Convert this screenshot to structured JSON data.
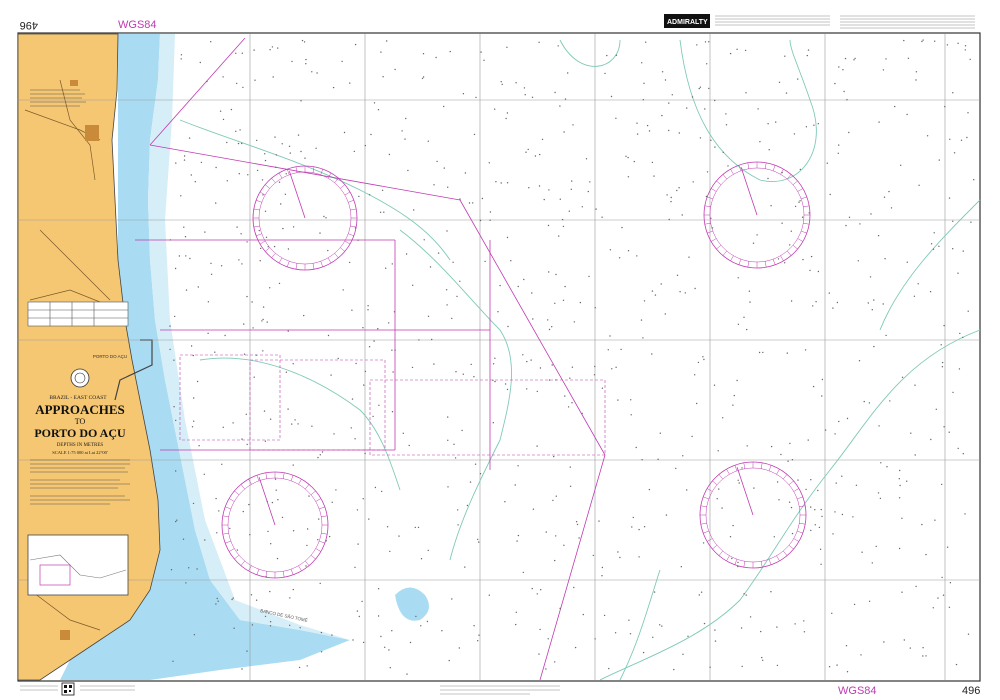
{
  "sheet": {
    "chart_number": "496",
    "datum": "WGS84",
    "publisher": "ADMIRALTY",
    "region": "BRAZIL - EAST COAST",
    "title_line1": "APPROACHES",
    "title_line2": "TO",
    "title_line3": "PORTO DO AÇU",
    "depths_unit": "DEPTHS IN METRES",
    "scale": "SCALE 1:75 000 at Lat 22°00'"
  },
  "places": {
    "port": "PORTO DO AÇU",
    "bank": "BANCO DE SÃO TOMÉ"
  },
  "colors": {
    "land": "#f6c772",
    "shallow": "#a9dcf2",
    "shallow_light": "#d6eef8",
    "magenta": "#c03ab3",
    "datum_label": "#c03ab3",
    "grid": "#9a9a9a"
  },
  "icons": {
    "publisher_logo": "admiralty-logo-icon",
    "qr": "qr-code-icon",
    "seal": "hydrographic-seal-icon"
  }
}
